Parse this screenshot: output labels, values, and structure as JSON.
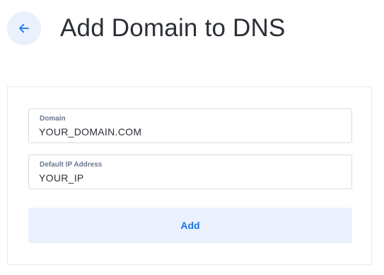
{
  "header": {
    "title": "Add Domain to DNS",
    "back_icon": "arrow-left-icon"
  },
  "form": {
    "domain": {
      "label": "Domain",
      "value": "YOUR_DOMAIN.COM"
    },
    "ip": {
      "label": "Default IP Address",
      "value": "YOUR_IP"
    },
    "submit_label": "Add"
  },
  "colors": {
    "accent": "#1a73e8",
    "button_bg": "#eaf1fd",
    "border": "#d7dbe2",
    "label": "#6b7a90",
    "text": "#2b2f36"
  }
}
